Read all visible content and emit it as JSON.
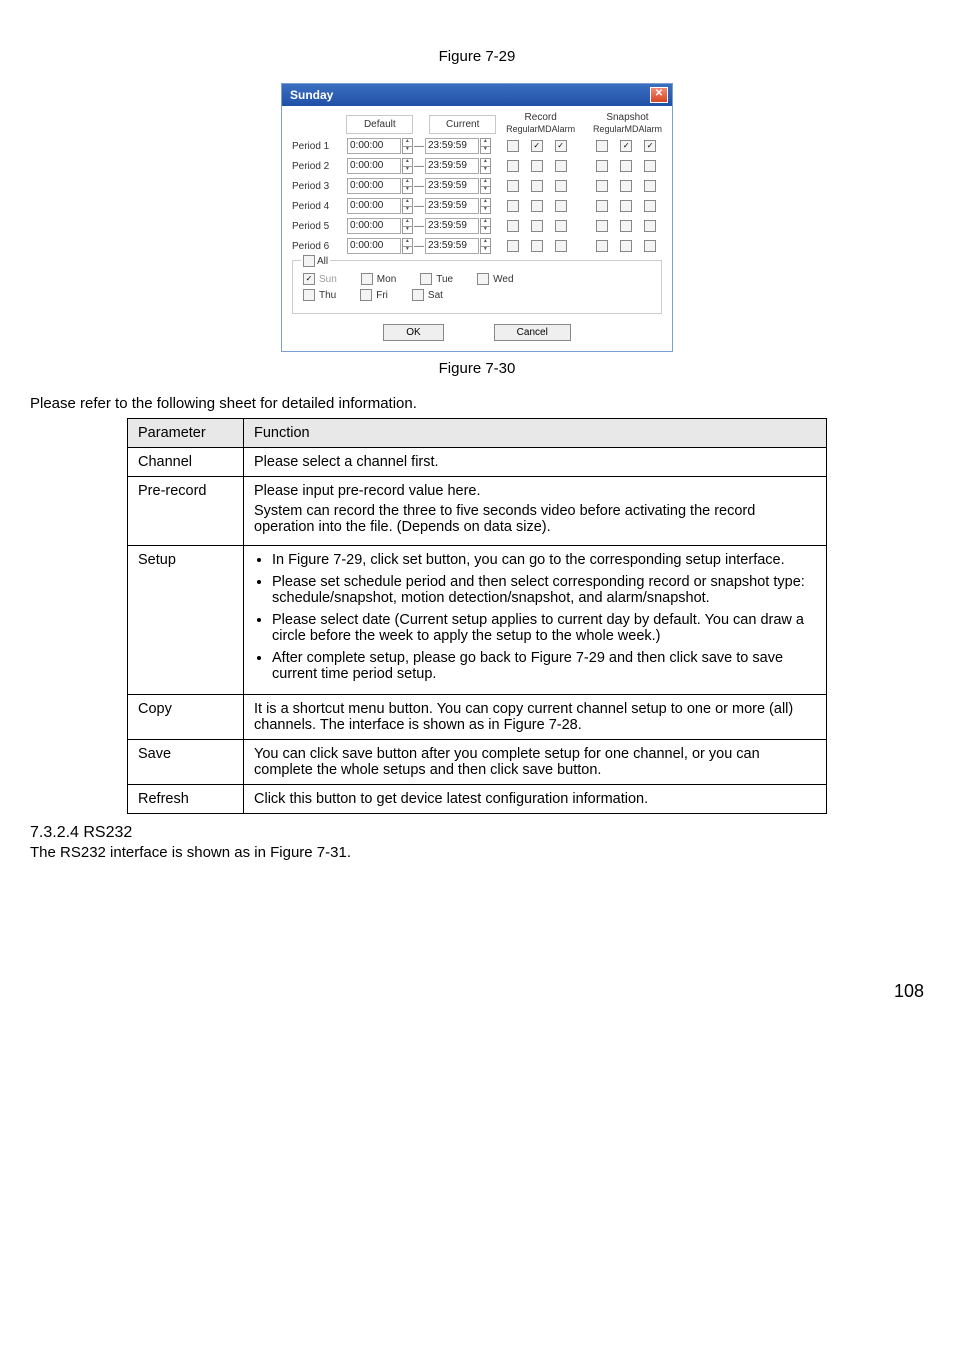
{
  "fig_caption_top": "Figure 7-29",
  "fig_caption_mid": "Figure 7-30",
  "intro": "Please refer to the following sheet for detailed information.",
  "dialog": {
    "title": "Sunday",
    "default_label": "Default",
    "current_label": "Current",
    "record_label": "Record",
    "snapshot_label": "Snapshot",
    "cols": {
      "regular": "Regular",
      "md": "MD",
      "alarm": "Alarm"
    },
    "periods": [
      {
        "label": "Period 1",
        "from": "0:00:00",
        "to": "23:59:59",
        "rec": [
          false,
          true,
          true
        ],
        "snap": [
          false,
          true,
          true
        ]
      },
      {
        "label": "Period 2",
        "from": "0:00:00",
        "to": "23:59:59",
        "rec": [
          false,
          false,
          false
        ],
        "snap": [
          false,
          false,
          false
        ]
      },
      {
        "label": "Period 3",
        "from": "0:00:00",
        "to": "23:59:59",
        "rec": [
          false,
          false,
          false
        ],
        "snap": [
          false,
          false,
          false
        ]
      },
      {
        "label": "Period 4",
        "from": "0:00:00",
        "to": "23:59:59",
        "rec": [
          false,
          false,
          false
        ],
        "snap": [
          false,
          false,
          false
        ]
      },
      {
        "label": "Period 5",
        "from": "0:00:00",
        "to": "23:59:59",
        "rec": [
          false,
          false,
          false
        ],
        "snap": [
          false,
          false,
          false
        ]
      },
      {
        "label": "Period 6",
        "from": "0:00:00",
        "to": "23:59:59",
        "rec": [
          false,
          false,
          false
        ],
        "snap": [
          false,
          false,
          false
        ]
      }
    ],
    "days": {
      "all": "All",
      "row1": [
        {
          "label": "Sun",
          "checked": true,
          "disabled": true
        },
        {
          "label": "Mon",
          "checked": false,
          "disabled": false
        },
        {
          "label": "Tue",
          "checked": false,
          "disabled": false
        },
        {
          "label": "Wed",
          "checked": false,
          "disabled": false
        }
      ],
      "row2": [
        {
          "label": "Thu",
          "checked": false,
          "disabled": false
        },
        {
          "label": "Fri",
          "checked": false,
          "disabled": false
        },
        {
          "label": "Sat",
          "checked": false,
          "disabled": false
        }
      ]
    },
    "ok": "OK",
    "cancel": "Cancel"
  },
  "table": {
    "parameter": "Parameter",
    "function": "Function",
    "rows": {
      "channel_l": "Channel",
      "channel_f": "Please select a channel first.",
      "prerecord_l": "Pre-record",
      "prerecord_f1": "Please input pre-record value here.",
      "prerecord_f2": "System can record the three to five seconds video before activating the record operation into the file. (Depends on data size).",
      "setup_l": "Setup",
      "setup_b1": "In Figure 7-29, click set button, you can go to the corresponding setup interface.",
      "setup_b2": "Please set schedule period and then select corresponding record or snapshot type: schedule/snapshot, motion detection/snapshot, and alarm/snapshot.",
      "setup_b3": "Please select date (Current setup applies to current day by default. You can draw a circle before the week to apply the setup to the whole week.)",
      "setup_b4": "After complete setup, please go back to Figure 7-29 and then click save to save current time period setup.",
      "copy_l": "Copy",
      "copy_f": "It is a shortcut menu button. You can copy current channel setup to one or more (all) channels.  The interface is shown as in Figure 7-28.",
      "save_l": "Save",
      "save_f": "You can click save button after you complete setup for one channel, or you can complete the whole setups and then click save button.",
      "refresh_l": "Refresh",
      "refresh_f": "Click this button to get device latest configuration information."
    }
  },
  "section": {
    "head": "7.3.2.4  RS232",
    "body": "The RS232 interface is shown as in Figure 7-31."
  },
  "page_number": "108"
}
